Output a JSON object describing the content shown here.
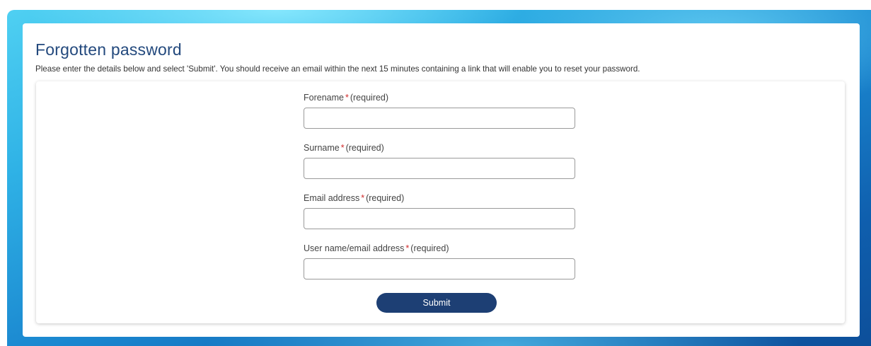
{
  "page": {
    "title": "Forgotten password",
    "intro": "Please enter the details below and select 'Submit'. You should receive an email within the next 15 minutes containing a link that will enable you to reset your password."
  },
  "form": {
    "required_marker": "*",
    "required_text": "(required)",
    "fields": [
      {
        "label": "Forename",
        "value": ""
      },
      {
        "label": "Surname",
        "value": ""
      },
      {
        "label": "Email address",
        "value": ""
      },
      {
        "label": "User name/email address",
        "value": ""
      }
    ],
    "submit_label": "Submit"
  },
  "colors": {
    "title": "#23497d",
    "required_star": "#d02a2a",
    "submit_button": "#1d3f74",
    "background_gradient_start": "#4fd0f2",
    "background_gradient_end": "#0d4f9a"
  }
}
